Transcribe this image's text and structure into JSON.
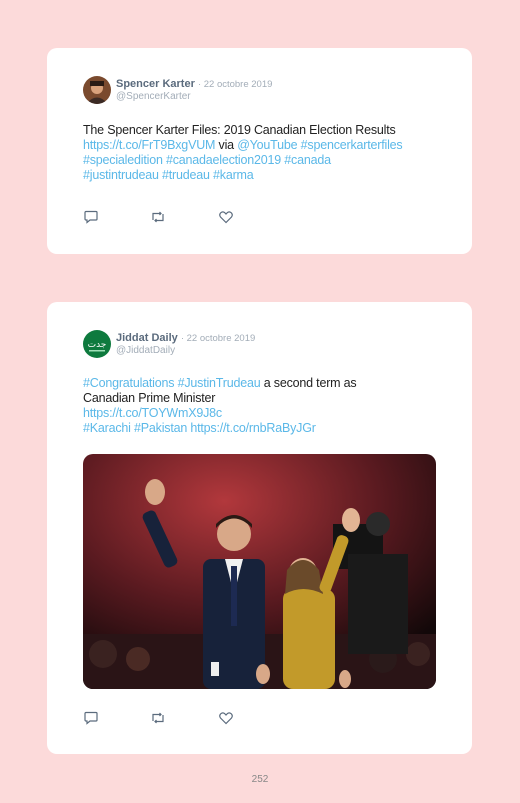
{
  "tweets": [
    {
      "author": "Spencer Karter",
      "date": "· 22 octobre 2019",
      "handle": "@SpencerKarter",
      "text": {
        "t1": "The Spencer Karter Files: 2019 Canadian Election Results",
        "url": "https://t.co/FrT9BxgVUM",
        "via": " via ",
        "mention": "@YouTube",
        "tags1": " #spencerkarterfiles",
        "tags2": "#specialedition #canadaelection2019 #canada",
        "tags3": "#justintrudeau #trudeau #karma"
      }
    },
    {
      "author": "Jiddat Daily",
      "date": "· 22 octobre 2019",
      "handle": "@JiddatDaily",
      "avatar_text": "جدت",
      "text": {
        "tag_a": "#Congratulations",
        "tag_b": " #JustinTrudeau",
        "t1": " a second term as",
        "t2": "Canadian Prime Minister",
        "url": "https://t.co/TOYWmX9J8c",
        "tags": "#Karachi #Pakistan",
        "url2": " https://t.co/rnbRaByJGr"
      }
    }
  ],
  "page_number": "252",
  "colors": {
    "page_bg": "#fcdada",
    "link": "#5bb8e8",
    "name": "#5b6b7d",
    "meta": "#a3adb8"
  },
  "icons": [
    "reply-icon",
    "retweet-icon",
    "like-icon"
  ]
}
